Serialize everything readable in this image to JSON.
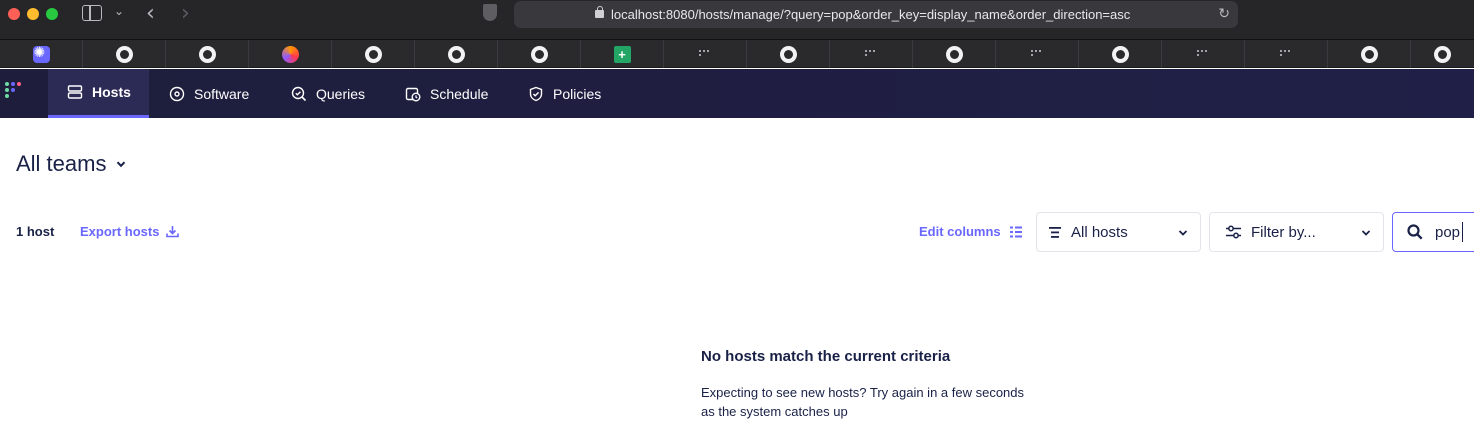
{
  "browser": {
    "url": "localhost:8080/hosts/manage/?query=pop&order_key=display_name&order_direction=asc"
  },
  "bookmarks": [
    {
      "icon": "fleet-icon"
    },
    {
      "icon": "github-icon"
    },
    {
      "icon": "github-icon"
    },
    {
      "icon": "firefox-icon"
    },
    {
      "icon": "github-icon"
    },
    {
      "icon": "github-icon"
    },
    {
      "icon": "github-icon"
    },
    {
      "icon": "sheets-icon",
      "glyph": "+"
    },
    {
      "icon": "dots-icon"
    },
    {
      "icon": "github-icon"
    },
    {
      "icon": "dots-icon"
    },
    {
      "icon": "github-icon"
    },
    {
      "icon": "dots-icon"
    },
    {
      "icon": "github-icon"
    },
    {
      "icon": "dots-icon"
    },
    {
      "icon": "dots-icon"
    },
    {
      "icon": "github-icon"
    },
    {
      "icon": "github-icon"
    }
  ],
  "nav": {
    "tabs": [
      {
        "label": "Hosts",
        "icon": "hosts-icon",
        "active": true
      },
      {
        "label": "Software",
        "icon": "software-icon",
        "active": false
      },
      {
        "label": "Queries",
        "icon": "queries-icon",
        "active": false
      },
      {
        "label": "Schedule",
        "icon": "schedule-icon",
        "active": false
      },
      {
        "label": "Policies",
        "icon": "policies-icon",
        "active": false
      }
    ]
  },
  "page": {
    "team": "All teams",
    "host_count": "1 host",
    "export_label": "Export hosts",
    "edit_columns_label": "Edit columns",
    "status_filter": "All hosts",
    "filter_label": "Filter by...",
    "search_value": "pop"
  },
  "empty_state": {
    "title": "No hosts match the current criteria",
    "line1": "Expecting to see new hosts? Try again in a few seconds",
    "line2": "as the system catches up"
  },
  "colors": {
    "accent": "#6a67fe",
    "text": "#192147",
    "nav_bg": "#201f47"
  }
}
